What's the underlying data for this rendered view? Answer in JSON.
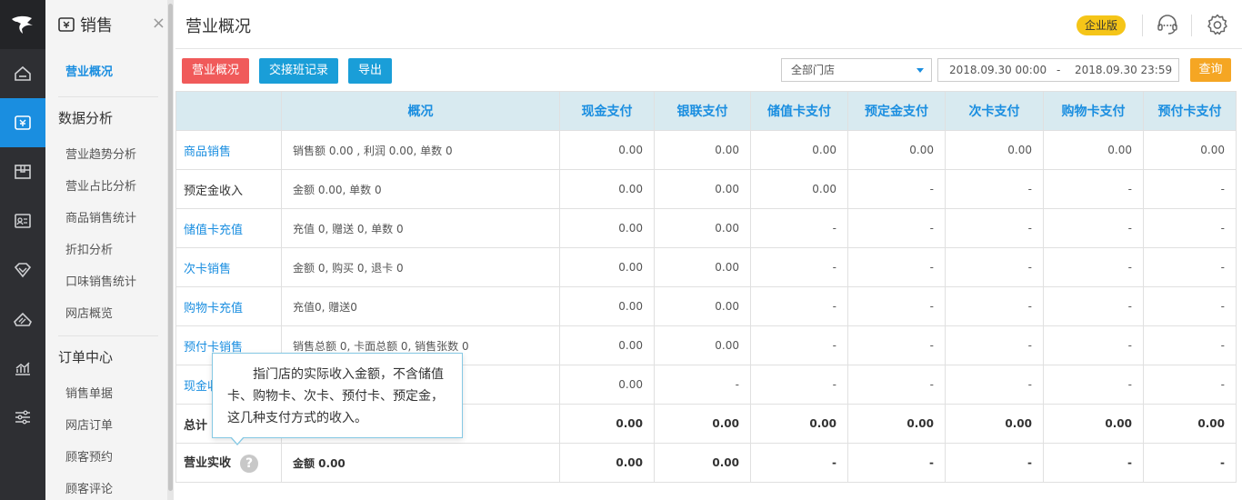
{
  "sidebar": {
    "title": "销售",
    "close": "×",
    "current": "营业概况",
    "groups": [
      {
        "label": "数据分析",
        "items": [
          "营业趋势分析",
          "营业占比分析",
          "商品销售统计",
          "折扣分析",
          "口味销售统计",
          "网店概览"
        ]
      },
      {
        "label": "订单中心",
        "items": [
          "销售单据",
          "网店订单",
          "顾客预约",
          "顾客评论"
        ]
      }
    ]
  },
  "rail_icons": [
    "logo-icon",
    "home-icon",
    "sales-icon",
    "box-icon",
    "member-card-icon",
    "diamond-icon",
    "promotion-icon",
    "chart-icon",
    "settings-sliders-icon"
  ],
  "header": {
    "title": "营业概况",
    "edition": "企业版"
  },
  "toolbar": {
    "btn_overview": "营业概况",
    "btn_shift": "交接班记录",
    "btn_export": "导出",
    "store": "全部门店",
    "date_start": "2018.09.30 00:00",
    "date_sep": "-",
    "date_end": "2018.09.30 23:59",
    "query": "查询"
  },
  "table": {
    "headers": [
      "",
      "概况",
      "现金支付",
      "银联支付",
      "储值卡支付",
      "预定金支付",
      "次卡支付",
      "购物卡支付",
      "预付卡支付"
    ],
    "rows": [
      {
        "name": "商品销售",
        "desc": "销售额 0.00 , 利润 0.00, 单数 0",
        "vals": [
          "0.00",
          "0.00",
          "0.00",
          "0.00",
          "0.00",
          "0.00",
          "0.00"
        ]
      },
      {
        "name": "预定金收入",
        "desc": "金额 0.00, 单数 0",
        "vals": [
          "0.00",
          "0.00",
          "0.00",
          "-",
          "-",
          "-",
          "-"
        ]
      },
      {
        "name": "储值卡充值",
        "desc": "充值 0, 赠送 0, 单数 0",
        "vals": [
          "0.00",
          "0.00",
          "-",
          "-",
          "-",
          "-",
          "-"
        ]
      },
      {
        "name": "次卡销售",
        "desc": "金额 0, 购买 0, 退卡 0",
        "vals": [
          "0.00",
          "0.00",
          "-",
          "-",
          "-",
          "-",
          "-"
        ]
      },
      {
        "name": "购物卡充值",
        "desc": "充值0, 赠送0",
        "vals": [
          "0.00",
          "0.00",
          "-",
          "-",
          "-",
          "-",
          "-"
        ]
      },
      {
        "name": "预付卡销售",
        "desc": "销售总额 0, 卡面总额 0, 销售张数 0",
        "vals": [
          "0.00",
          "0.00",
          "-",
          "-",
          "-",
          "-",
          "-"
        ]
      },
      {
        "name": "现金收",
        "desc": "",
        "vals": [
          "0.00",
          "-",
          "-",
          "-",
          "-",
          "-",
          "-"
        ]
      },
      {
        "name": "总计",
        "desc": "",
        "vals": [
          "0.00",
          "0.00",
          "0.00",
          "0.00",
          "0.00",
          "0.00",
          "0.00"
        ]
      },
      {
        "name": "营业实收",
        "desc": "金额 0.00",
        "vals": [
          "0.00",
          "0.00",
          "-",
          "-",
          "-",
          "-",
          "-"
        ]
      }
    ]
  },
  "tooltip": {
    "text": "指门店的实际收入金额，不含储值卡、购物卡、次卡、预付卡、预定金，这几种支付方式的收入。",
    "help": "?"
  },
  "colors": {
    "rail": "#2e2f33",
    "accent": "#1a8ee0",
    "red_button": "#f05a5a",
    "query": "#f5a623",
    "edition": "#f5c518",
    "header_bg": "#d8eaf0"
  }
}
